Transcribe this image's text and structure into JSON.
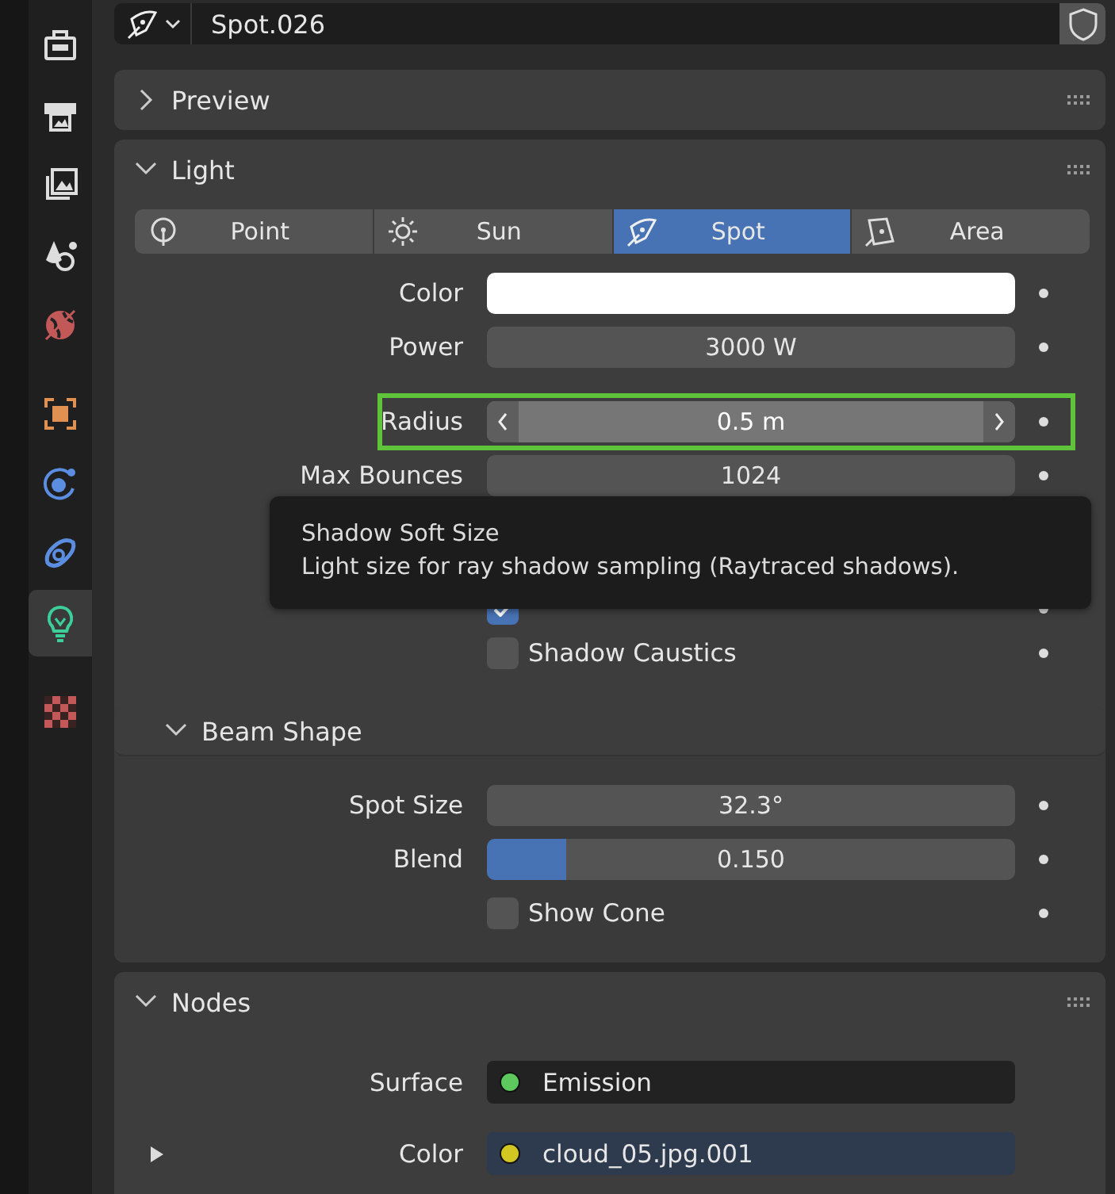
{
  "sidebar": {
    "tabs": [
      {
        "kind": "tool",
        "selected": false
      },
      {
        "kind": "render",
        "selected": false
      },
      {
        "kind": "output",
        "selected": false
      },
      {
        "kind": "scene",
        "selected": false
      },
      {
        "kind": "world",
        "selected": false
      },
      {
        "kind": "object",
        "selected": false
      },
      {
        "kind": "physics",
        "selected": false
      },
      {
        "kind": "constraint",
        "selected": false
      },
      {
        "kind": "data",
        "selected": true
      },
      {
        "kind": "texture",
        "selected": false
      }
    ]
  },
  "datablock": {
    "name": "Spot.026"
  },
  "preview_panel": {
    "title": "Preview",
    "expanded": false
  },
  "light_panel": {
    "title": "Light",
    "expanded": true,
    "light_types": [
      {
        "label": "Point",
        "kind": "point",
        "selected": false
      },
      {
        "label": "Sun",
        "kind": "sun",
        "selected": false
      },
      {
        "label": "Spot",
        "kind": "spot",
        "selected": true
      },
      {
        "label": "Area",
        "kind": "area",
        "selected": false
      }
    ],
    "properties": [
      {
        "kind": "color",
        "label": "Color",
        "color": "#ffffff"
      },
      {
        "kind": "number",
        "label": "Power",
        "value": "3000 W"
      },
      {
        "kind": "number",
        "label": "Radius",
        "value": "0.5 m",
        "hovered": true,
        "highlighted": true
      },
      {
        "kind": "number",
        "label": "Max Bounces",
        "value": "1024"
      },
      {
        "kind": "checkbox",
        "checked": true
      },
      {
        "kind": "checkbox",
        "label": "Shadow Caustics",
        "checked": false
      }
    ],
    "beam_shape": {
      "title": "Beam Shape",
      "expanded": true,
      "properties": [
        {
          "kind": "number",
          "label": "Spot Size",
          "value": "32.3°"
        },
        {
          "kind": "slider",
          "label": "Blend",
          "value": "0.150",
          "level": 0.15
        },
        {
          "kind": "checkbox",
          "label": "Show Cone",
          "checked": false
        }
      ]
    }
  },
  "tooltip": {
    "title": "Shadow Soft Size",
    "description": "Light size for ray shadow sampling (Raytraced shadows)."
  },
  "nodes_panel": {
    "title": "Nodes",
    "expanded": true,
    "sockets": [
      {
        "label": "Surface",
        "value": "Emission",
        "kind": "shader",
        "color": "#5dc85d"
      },
      {
        "label": "Color",
        "value": "cloud_05.jpg.001",
        "kind": "texture",
        "color": "#d2c622",
        "expanded": false
      }
    ]
  }
}
